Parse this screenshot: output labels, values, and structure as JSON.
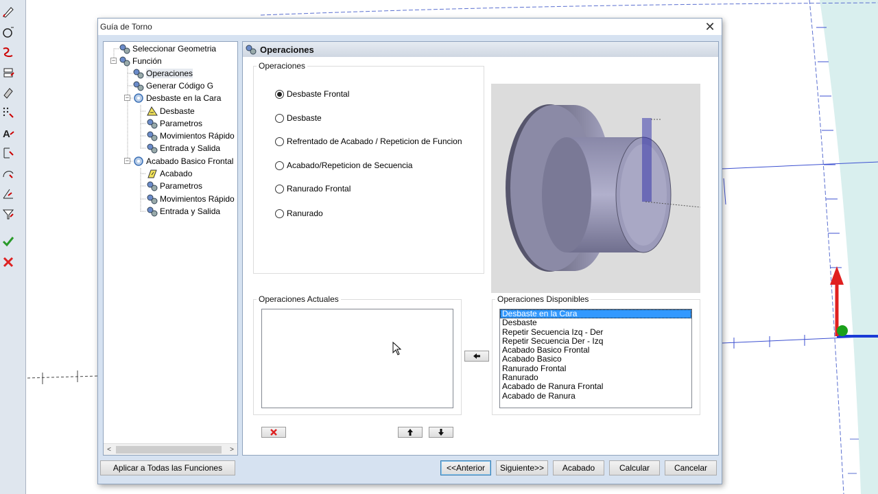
{
  "dialog": {
    "title": "Guía de Torno",
    "close": "✕"
  },
  "tree": {
    "items": [
      {
        "label": "Seleccionar Geometria",
        "icon": "gear-icon",
        "level": 1
      },
      {
        "label": "Función",
        "icon": "gear-icon",
        "level": 1,
        "expanded": true
      },
      {
        "label": "Operaciones",
        "icon": "gear-icon",
        "level": 2,
        "selected": true
      },
      {
        "label": "Generar Código G",
        "icon": "gear-icon",
        "level": 2
      },
      {
        "label": "Desbaste en la Cara",
        "icon": "gear-icon",
        "level": 2,
        "expanded": true
      },
      {
        "label": "Desbaste",
        "icon": "roughing-icon",
        "level": 3
      },
      {
        "label": "Parametros",
        "icon": "gear-icon",
        "level": 3
      },
      {
        "label": "Movimientos Rápido",
        "icon": "gear-icon",
        "level": 3
      },
      {
        "label": "Entrada y Salida",
        "icon": "gear-icon",
        "level": 3
      },
      {
        "label": "Acabado Basico Frontal",
        "icon": "gear-icon",
        "level": 2,
        "expanded": true
      },
      {
        "label": "Acabado",
        "icon": "finishing-icon",
        "level": 3
      },
      {
        "label": "Parametros",
        "icon": "gear-icon",
        "level": 3
      },
      {
        "label": "Movimientos Rápido",
        "icon": "gear-icon",
        "level": 3
      },
      {
        "label": "Entrada y Salida",
        "icon": "gear-icon",
        "level": 3
      }
    ],
    "scroll_left": "<",
    "scroll_right": ">"
  },
  "panel": {
    "title": "Operaciones",
    "operations_group": "Operaciones",
    "radio_options": [
      {
        "label": "Desbaste Frontal",
        "checked": true
      },
      {
        "label": "Desbaste",
        "checked": false
      },
      {
        "label": "Refrentado de Acabado / Repeticion de Funcion",
        "checked": false
      },
      {
        "label": "Acabado/Repeticion de Secuencia",
        "checked": false
      },
      {
        "label": "Ranurado Frontal",
        "checked": false
      },
      {
        "label": "Ranurado",
        "checked": false
      }
    ],
    "current_ops_group": "Operaciones Actuales",
    "current_ops": [],
    "available_ops_group": "Operaciones Disponibles",
    "available_ops": [
      {
        "label": "Desbaste en la Cara",
        "selected": true
      },
      {
        "label": "Desbaste"
      },
      {
        "label": "Repetir Secuencia Izq - Der"
      },
      {
        "label": "Repetir Secuencia Der - Izq"
      },
      {
        "label": "Acabado Basico Frontal"
      },
      {
        "label": "Acabado Basico"
      },
      {
        "label": "Ranurado Frontal"
      },
      {
        "label": "Ranurado"
      },
      {
        "label": "Acabado de Ranura Frontal"
      },
      {
        "label": "Acabado de Ranura"
      }
    ]
  },
  "buttons": {
    "apply_all": "Aplicar a Todas las Funciones",
    "previous": "<<Anterior",
    "next": "Siguiente>>",
    "finish": "Acabado",
    "calculate": "Calcular",
    "cancel": "Cancelar"
  },
  "colors": {
    "selection": "#3399ff",
    "dialog_bg": "#d6e2f1",
    "axis_red": "#e02020",
    "axis_green": "#1aa01a",
    "axis_blue": "#1a3bd6"
  }
}
